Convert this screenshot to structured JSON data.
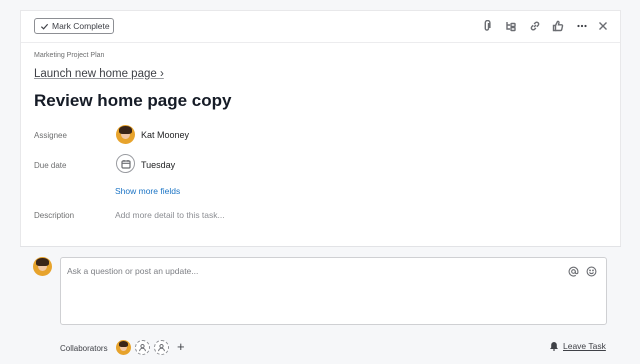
{
  "toolbar": {
    "mark_complete_label": "Mark Complete",
    "icons": [
      "attachment-icon",
      "subtask-icon",
      "link-icon",
      "like-icon",
      "more-icon",
      "close-icon"
    ]
  },
  "task": {
    "project": "Marketing Project Plan",
    "parent_task": "Launch new home page ›",
    "title": "Review home page copy"
  },
  "fields": {
    "assignee_label": "Assignee",
    "assignee_name": "Kat Mooney",
    "due_date_label": "Due date",
    "due_date_value": "Tuesday",
    "show_more_label": "Show more fields",
    "description_label": "Description",
    "description_placeholder": "Add more detail to this task..."
  },
  "comment": {
    "placeholder": "Ask a question or post an update..."
  },
  "footer": {
    "collaborators_label": "Collaborators",
    "add_label": "+",
    "leave_task_label": "Leave Task"
  },
  "colors": {
    "link_blue": "#1b74c5",
    "avatar_orange": "#e7a32c"
  }
}
